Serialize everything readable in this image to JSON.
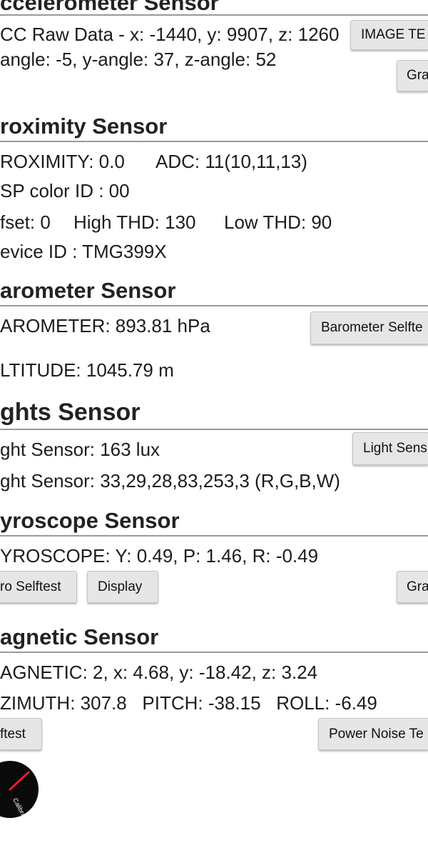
{
  "accelerometer": {
    "title": "ccelerometer Sensor",
    "raw": "CC Raw Data - x: -1440, y: 9907, z: 1260",
    "angle": "angle: -5, y-angle: 37, z-angle: 52",
    "image_button": "IMAGE TE",
    "graph_button": "Gra"
  },
  "proximity": {
    "title": "roximity Sensor",
    "value": "ROXIMITY: 0.0",
    "adc": "ADC: 11(10,11,13)",
    "color_id": "SP color ID : 00",
    "offset": "fset: 0",
    "high_thd": "High THD: 130",
    "low_thd": "Low THD: 90",
    "device_id": "evice ID : TMG399X"
  },
  "barometer": {
    "title": "arometer Sensor",
    "value": "AROMETER: 893.81 hPa",
    "altitude": "LTITUDE: 1045.79 m",
    "selftest_button": "Barometer Selfte"
  },
  "lights": {
    "title": "ghts Sensor",
    "lux": "ght Sensor: 163 lux",
    "rgbw": "ght Sensor: 33,29,28,83,253,3 (R,G,B,W)",
    "button": "Light Sens"
  },
  "gyroscope": {
    "title": "yroscope Sensor",
    "value": "YROSCOPE: Y: 0.49, P: 1.46, R: -0.49",
    "selftest_button": "ro Selftest",
    "display_button": "Display",
    "graph_button": "Gra"
  },
  "magnetic": {
    "title": "agnetic Sensor",
    "value": "AGNETIC: 2, x: 4.68, y: -18.42, z: 3.24",
    "orientation": "ZIMUTH: 307.8   PITCH: -38.15   ROLL: -6.49",
    "selftest_button": "ftest",
    "power_noise_button": "Power Noise Te",
    "dial_label": "Calibration",
    "dial_needle_color": "#e0202a"
  }
}
